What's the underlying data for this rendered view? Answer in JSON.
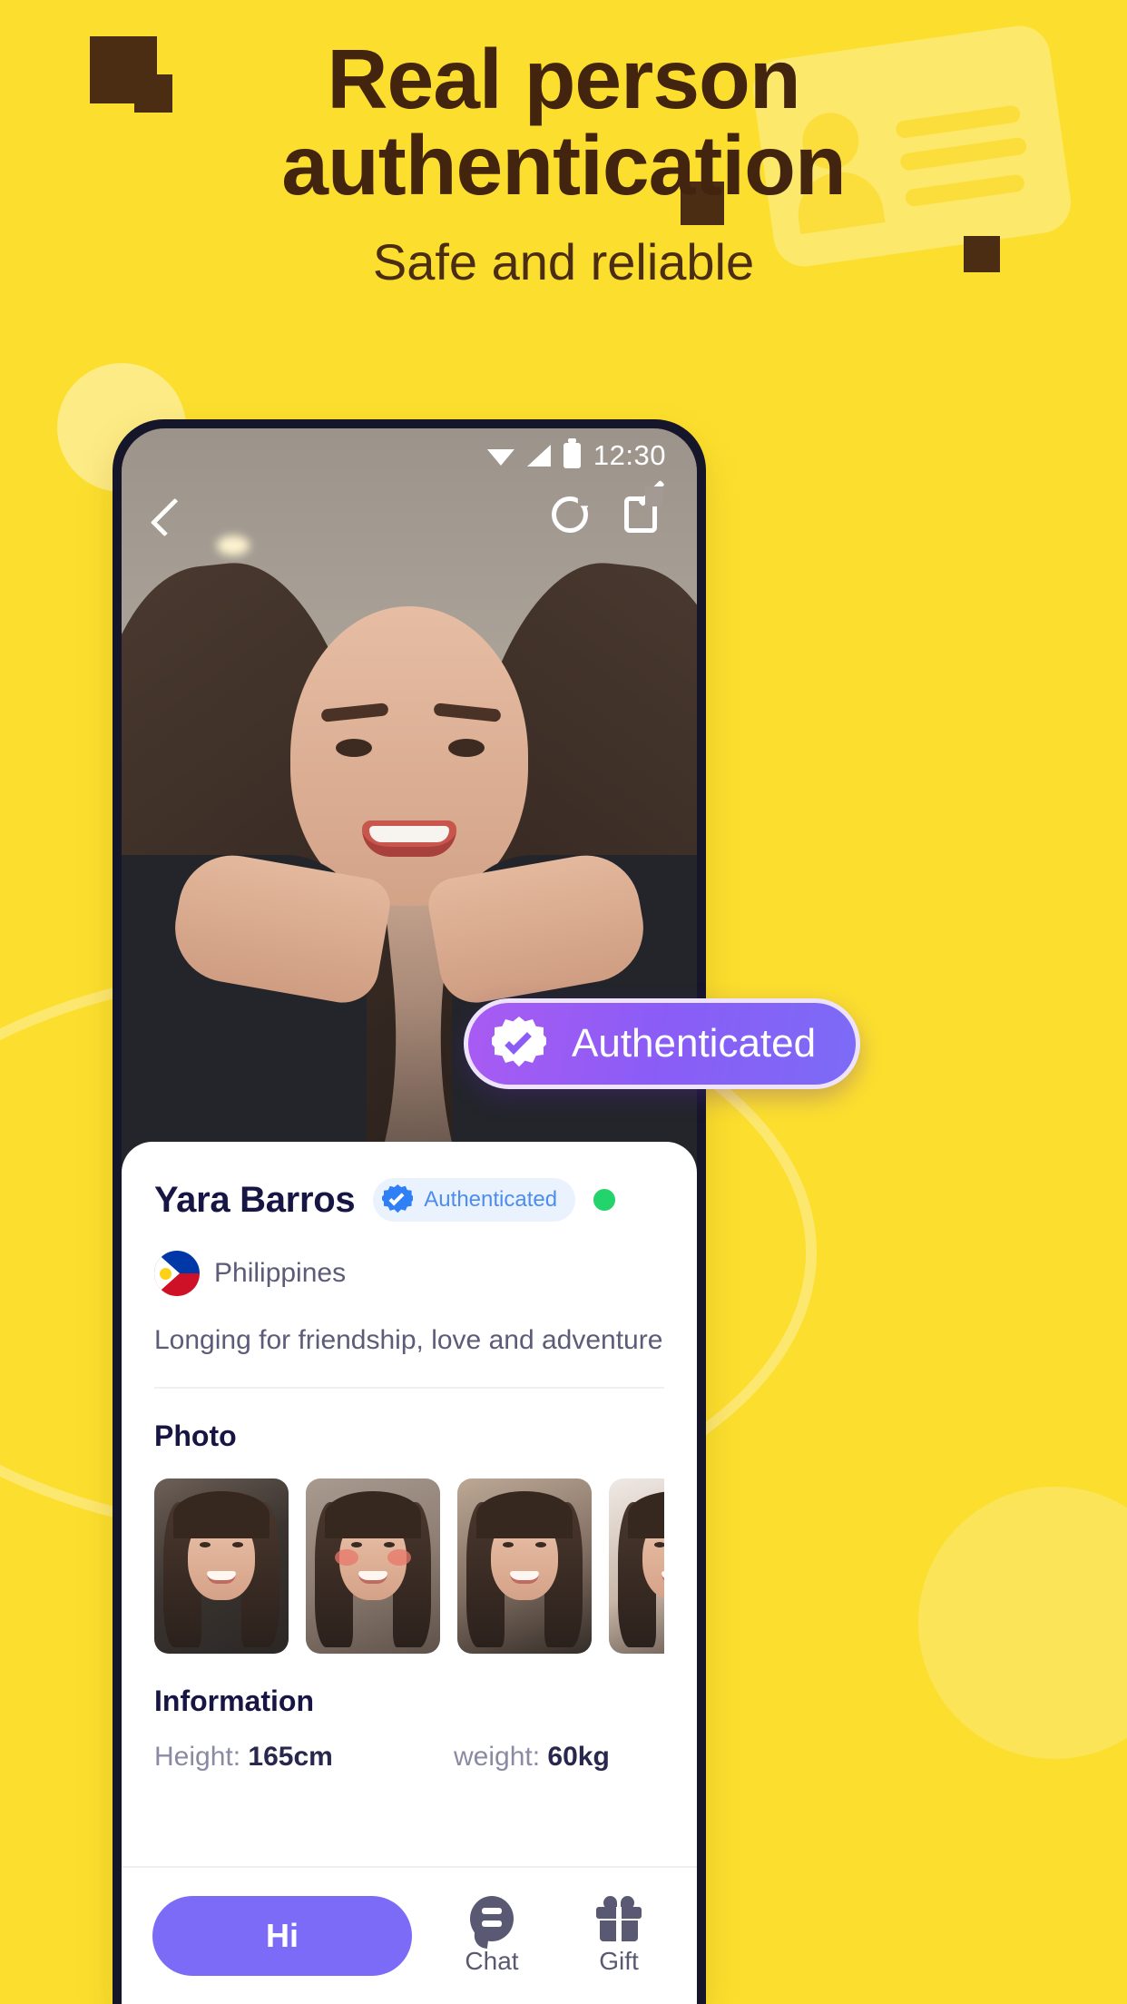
{
  "promo": {
    "headline_line1": "Real person",
    "headline_line2": "authentication",
    "subtitle": "Safe and reliable"
  },
  "phone": {
    "status_bar": {
      "time": "12:30",
      "wifi_icon": "wifi-icon",
      "signal_icon": "signal-icon",
      "battery_icon": "battery-icon"
    },
    "nav": {
      "back_icon": "back-chevron-icon",
      "refresh_icon": "refresh-icon",
      "edit_icon": "edit-icon"
    },
    "carousel": {
      "total_dots": 6,
      "active_index": 1
    }
  },
  "auth_badge": {
    "label": "Authenticated",
    "icon": "verified-starburst-icon",
    "gradient_from": "#A95BF2",
    "gradient_to": "#7C6BF6",
    "border_color": "#EDE3FC"
  },
  "profile": {
    "name": "Yara Barros",
    "verified_chip": {
      "label": "Authenticated",
      "icon": "verified-badge-icon",
      "text_color": "#4D8DF0",
      "bg_color": "#EAF2FE"
    },
    "online_status_color": "#22D46B",
    "country": "Philippines",
    "country_flag_icon": "philippines-flag-icon",
    "bio": "Longing for friendship, love and adventure"
  },
  "photo_section": {
    "title": "Photo",
    "thumbnails": [
      {
        "alt": "photo-1"
      },
      {
        "alt": "photo-2"
      },
      {
        "alt": "photo-3"
      },
      {
        "alt": "photo-4"
      }
    ]
  },
  "information": {
    "title": "Information",
    "height_label": "Height:",
    "height_value": "165cm",
    "weight_label": "weight:",
    "weight_value": "60kg"
  },
  "bottom_bar": {
    "primary_label": "Hi",
    "primary_color": "#7C6BF6",
    "chat_label": "Chat",
    "chat_icon": "chat-bubble-icon",
    "gift_label": "Gift",
    "gift_icon": "gift-box-icon"
  },
  "theme": {
    "background": "#FCDF2E",
    "headline_color": "#43250F"
  }
}
